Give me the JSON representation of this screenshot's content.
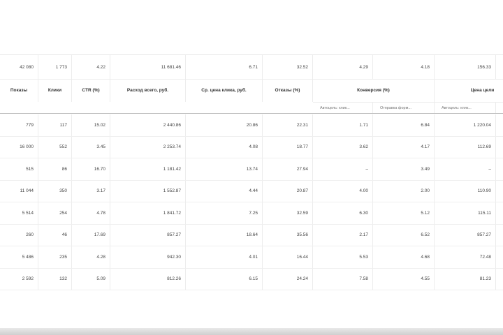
{
  "totals": [
    "42 080",
    "1 773",
    "4.22",
    "11 681.46",
    "6.71",
    "32.52",
    "4.29",
    "4.18",
    "156.33"
  ],
  "headers": {
    "impressions": "Показы",
    "clicks": "Клики",
    "ctr": "CTR (%)",
    "spend": "Расход всего, руб.",
    "avg_cpc": "Ср. цена клика, руб.",
    "bounces": "Отказы (%)",
    "conversion": "Конверсия (%)",
    "goal_price": "Цена цели"
  },
  "subheaders": [
    "Автоцель: клик...",
    "Отправка форм...",
    "Автоцель: клик...",
    "О"
  ],
  "rows": [
    [
      "779",
      "117",
      "15.02",
      "2 440.86",
      "20.86",
      "22.31",
      "1.71",
      "6.84",
      "1 220.04"
    ],
    [
      "16 000",
      "552",
      "3.45",
      "2 253.74",
      "4.08",
      "18.77",
      "3.62",
      "4.17",
      "112.69"
    ],
    [
      "515",
      "86",
      "16.70",
      "1 181.42",
      "13.74",
      "27.94",
      "–",
      "3.49",
      "–"
    ],
    [
      "11 044",
      "350",
      "3.17",
      "1 552.87",
      "4.44",
      "20.87",
      "4.00",
      "2.00",
      "110.90"
    ],
    [
      "5 514",
      "254",
      "4.78",
      "1 841.72",
      "7.25",
      "32.59",
      "6.30",
      "5.12",
      "115.11"
    ],
    [
      "260",
      "46",
      "17.69",
      "857.27",
      "18.64",
      "35.56",
      "2.17",
      "6.52",
      "857.27"
    ],
    [
      "5 486",
      "235",
      "4.28",
      "942.30",
      "4.01",
      "16.44",
      "5.53",
      "4.68",
      "72.48"
    ],
    [
      "2 592",
      "132",
      "5.09",
      "812.26",
      "6.15",
      "24.24",
      "7.58",
      "4.55",
      "81.23"
    ]
  ]
}
